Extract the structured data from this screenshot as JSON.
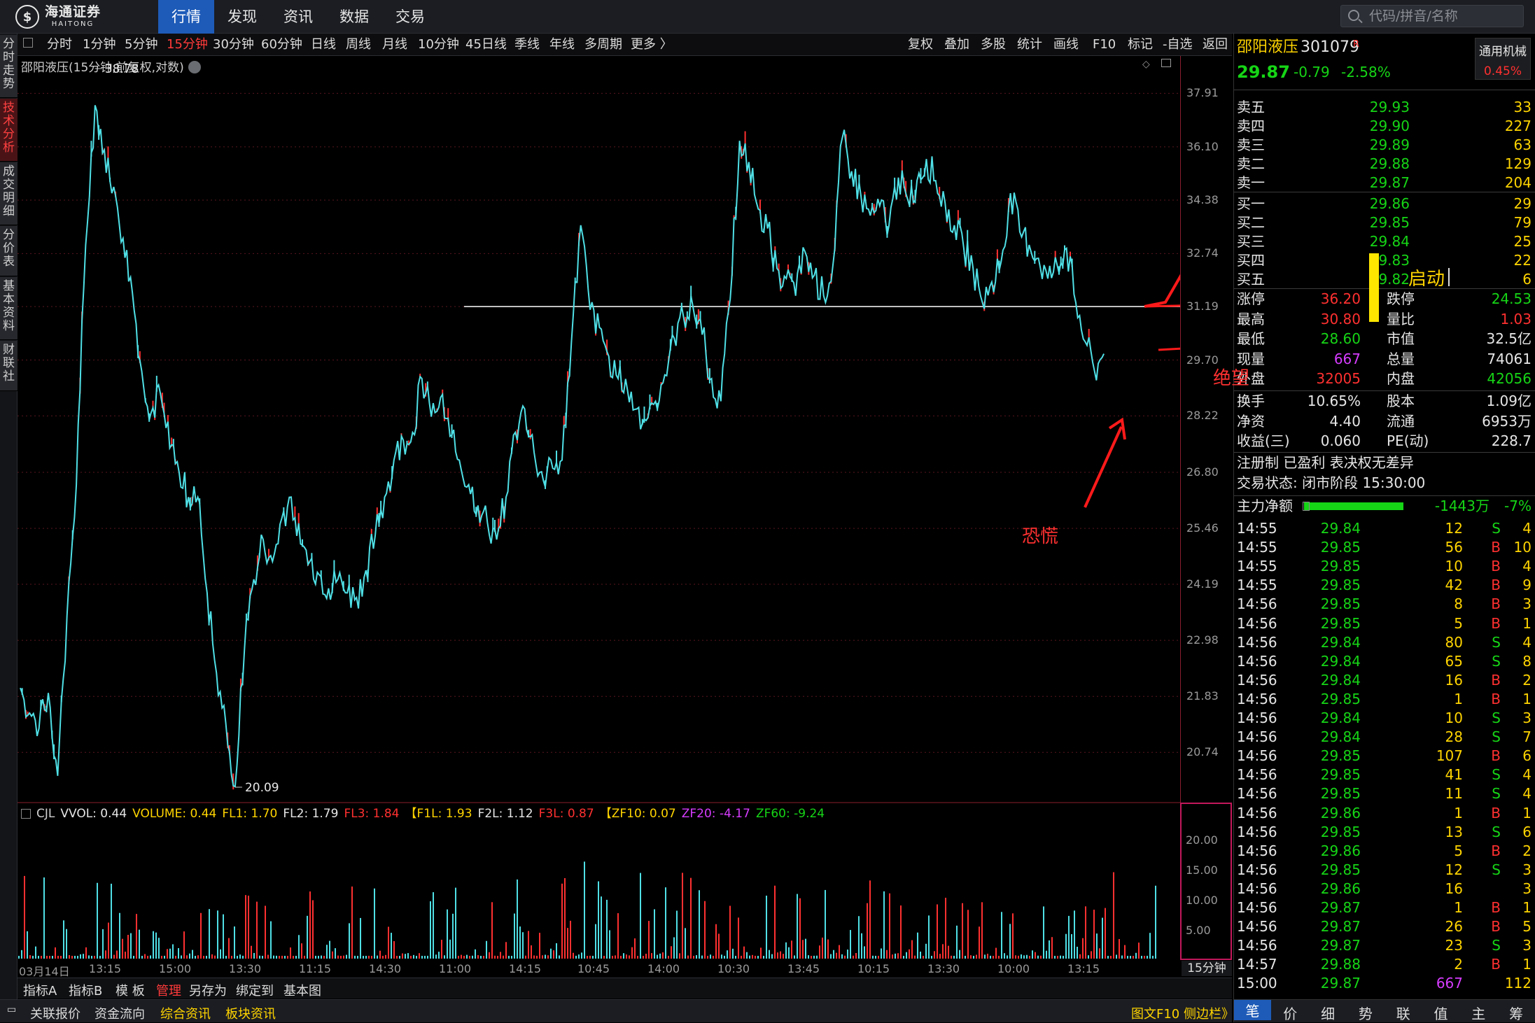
{
  "app": {
    "logo_cn": "海通证券",
    "logo_en": "HAITONG"
  },
  "nav": {
    "tabs": [
      "行情",
      "发现",
      "资讯",
      "数据",
      "交易"
    ],
    "active": "行情"
  },
  "search": {
    "placeholder": "代码/拼音/名称"
  },
  "side_tabs": [
    "分时走势",
    "技术分析",
    "成交明细",
    "分价表",
    "基本资料",
    "财联社"
  ],
  "periods": [
    "分时",
    "1分钟",
    "5分钟",
    "15分钟",
    "30分钟",
    "60分钟",
    "日线",
    "周线",
    "月线",
    "10分钟",
    "45日线",
    "季线",
    "年线",
    "多周期",
    "更多 〉"
  ],
  "active_period": "15分钟",
  "tools": [
    "复权",
    "叠加",
    "多股",
    "统计",
    "画线",
    "F10",
    "标记",
    "-自选",
    "返回"
  ],
  "chart_title": "邵阳液压(15分钟,前复权,对数)",
  "price_axis": [
    "37.91",
    "36.10",
    "34.38",
    "32.74",
    "31.19",
    "29.70",
    "28.22",
    "26.80",
    "25.46",
    "24.19",
    "22.98",
    "21.83",
    "20.74"
  ],
  "high_label": "38.78",
  "low_label": "20.09",
  "vol_axis": [
    "20.00",
    "15.00",
    "10.00",
    "5.00"
  ],
  "vol_header": [
    {
      "t": "CJL",
      "c": "#d0d0d0"
    },
    {
      "t": "VVOL: 0.44",
      "c": "#e6e6e6"
    },
    {
      "t": "VOLUME: 0.44",
      "c": "#ffd400"
    },
    {
      "t": "FL1: 1.70",
      "c": "#ffd400"
    },
    {
      "t": "FL2: 1.79",
      "c": "#e6e6e6"
    },
    {
      "t": "FL3: 1.84",
      "c": "#ff3030"
    },
    {
      "t": "【F1L: 1.93",
      "c": "#ffd400"
    },
    {
      "t": "F2L: 1.12",
      "c": "#e6e6e6"
    },
    {
      "t": "F3L: 0.87",
      "c": "#ff3030"
    },
    {
      "t": "【ZF10: 0.07",
      "c": "#ffd400"
    },
    {
      "t": "ZF20: -4.17",
      "c": "#d63cff"
    },
    {
      "t": "ZF60: -9.24",
      "c": "#16d516"
    }
  ],
  "time_axis": [
    "03月14日",
    "13:15",
    "15:00",
    "13:30",
    "11:15",
    "14:30",
    "11:00",
    "14:15",
    "10:45",
    "14:00",
    "10:30",
    "13:45",
    "10:15",
    "13:30",
    "10:00",
    "13:15"
  ],
  "period_label": "15分钟",
  "bottom_tabs1": [
    "指标A",
    "指标B",
    "模 板",
    "管理",
    "另存为",
    "绑定到",
    "基本图"
  ],
  "bottom_tabs1_active": "管理",
  "bottom_tabs2": [
    "关联报价",
    "资金流向",
    "综合资讯",
    "板块资讯"
  ],
  "bottom_right": "图文F10 侧边栏》",
  "stock": {
    "name": "邵阳液压",
    "code": "301079",
    "mark": "R",
    "industry": "通用机械",
    "industry_pct": "0.45%",
    "price": "29.87",
    "change": "-0.79",
    "pct": "-2.58%"
  },
  "asks": [
    {
      "label": "卖五",
      "price": "29.93",
      "vol": "33"
    },
    {
      "label": "卖四",
      "price": "29.90",
      "vol": "227"
    },
    {
      "label": "卖三",
      "price": "29.89",
      "vol": "63"
    },
    {
      "label": "卖二",
      "price": "29.88",
      "vol": "129"
    },
    {
      "label": "卖一",
      "price": "29.87",
      "vol": "204"
    }
  ],
  "bids": [
    {
      "label": "买一",
      "price": "29.86",
      "vol": "29"
    },
    {
      "label": "买二",
      "price": "29.85",
      "vol": "79"
    },
    {
      "label": "买三",
      "price": "29.84",
      "vol": "25"
    },
    {
      "label": "买四",
      "price": "29.83",
      "vol": "22"
    },
    {
      "label": "买五",
      "price": "29.82",
      "vol": "6"
    }
  ],
  "stats": [
    {
      "l1": "涨停",
      "v1": "36.20",
      "c1": "red",
      "l2": "跌停",
      "v2": "24.53",
      "c2": "green"
    },
    {
      "l1": "最高",
      "v1": "30.80",
      "c1": "red",
      "l2": "量比",
      "v2": "1.03",
      "c2": "red"
    },
    {
      "l1": "最低",
      "v1": "28.60",
      "c1": "green",
      "l2": "市值",
      "v2": "32.5亿",
      "c2": "white"
    },
    {
      "l1": "现量",
      "v1": "667",
      "c1": "purple",
      "l2": "总量",
      "v2": "74061",
      "c2": "white"
    },
    {
      "l1": "外盘",
      "v1": "32005",
      "c1": "red",
      "l2": "内盘",
      "v2": "42056",
      "c2": "green"
    }
  ],
  "stats2": [
    {
      "l1": "换手",
      "v1": "10.65%",
      "l2": "股本",
      "v2": "1.09亿"
    },
    {
      "l1": "净资",
      "v1": "4.40",
      "l2": "流通",
      "v2": "6953万"
    },
    {
      "l1": "收益(三)",
      "v1": "0.060",
      "l2": "PE(动)",
      "v2": "228.7"
    }
  ],
  "reg": "注册制 已盈利 表决权无差异",
  "trade_status": "交易状态: 闭市阶段 15:30:00",
  "main_flow": {
    "label": "主力净额",
    "value": "-1443万",
    "pct": "-7%"
  },
  "ticks": [
    {
      "t": "14:55",
      "p": "29.84",
      "v": "12",
      "d": "S",
      "n": "4"
    },
    {
      "t": "14:55",
      "p": "29.85",
      "v": "56",
      "d": "B",
      "n": "10"
    },
    {
      "t": "14:55",
      "p": "29.85",
      "v": "10",
      "d": "B",
      "n": "4"
    },
    {
      "t": "14:55",
      "p": "29.85",
      "v": "42",
      "d": "B",
      "n": "9"
    },
    {
      "t": "14:56",
      "p": "29.85",
      "v": "8",
      "d": "B",
      "n": "3"
    },
    {
      "t": "14:56",
      "p": "29.85",
      "v": "5",
      "d": "B",
      "n": "1"
    },
    {
      "t": "14:56",
      "p": "29.84",
      "v": "80",
      "d": "S",
      "n": "4"
    },
    {
      "t": "14:56",
      "p": "29.84",
      "v": "65",
      "d": "S",
      "n": "8"
    },
    {
      "t": "14:56",
      "p": "29.84",
      "v": "16",
      "d": "B",
      "n": "2"
    },
    {
      "t": "14:56",
      "p": "29.85",
      "v": "1",
      "d": "B",
      "n": "1"
    },
    {
      "t": "14:56",
      "p": "29.84",
      "v": "10",
      "d": "S",
      "n": "3"
    },
    {
      "t": "14:56",
      "p": "29.84",
      "v": "28",
      "d": "S",
      "n": "7"
    },
    {
      "t": "14:56",
      "p": "29.85",
      "v": "107",
      "d": "B",
      "n": "6"
    },
    {
      "t": "14:56",
      "p": "29.85",
      "v": "41",
      "d": "S",
      "n": "4"
    },
    {
      "t": "14:56",
      "p": "29.85",
      "v": "11",
      "d": "S",
      "n": "4"
    },
    {
      "t": "14:56",
      "p": "29.86",
      "v": "1",
      "d": "B",
      "n": "1"
    },
    {
      "t": "14:56",
      "p": "29.85",
      "v": "13",
      "d": "S",
      "n": "6"
    },
    {
      "t": "14:56",
      "p": "29.86",
      "v": "5",
      "d": "B",
      "n": "2"
    },
    {
      "t": "14:56",
      "p": "29.85",
      "v": "12",
      "d": "S",
      "n": "3"
    },
    {
      "t": "14:56",
      "p": "29.86",
      "v": "16",
      "d": "",
      "n": "3"
    },
    {
      "t": "14:56",
      "p": "29.87",
      "v": "1",
      "d": "B",
      "n": "1"
    },
    {
      "t": "14:56",
      "p": "29.87",
      "v": "26",
      "d": "B",
      "n": "5"
    },
    {
      "t": "14:56",
      "p": "29.87",
      "v": "23",
      "d": "S",
      "n": "3"
    },
    {
      "t": "14:57",
      "p": "29.88",
      "v": "2",
      "d": "B",
      "n": "1"
    },
    {
      "t": "15:00",
      "p": "29.87",
      "v": "667",
      "d": "",
      "n": "112"
    }
  ],
  "right_tabs": [
    "笔",
    "价",
    "细",
    "势",
    "联",
    "值",
    "主",
    "筹"
  ],
  "annotations": {
    "start": "启动",
    "despair": "绝望",
    "panic": "恐慌"
  },
  "chart_data": {
    "type": "line",
    "scale": "log",
    "ylim": [
      20.09,
      38.78
    ],
    "y_ticks": [
      37.91,
      36.1,
      34.38,
      32.74,
      31.19,
      29.7,
      28.22,
      26.8,
      25.46,
      24.19,
      22.98,
      21.83,
      20.74
    ],
    "price_path": [
      22.0,
      21.5,
      21.2,
      21.9,
      20.3,
      23.5,
      26.5,
      33.0,
      37.5,
      36.0,
      34.8,
      33.2,
      31.6,
      29.4,
      28.3,
      28.8,
      27.4,
      26.8,
      26.2,
      26.2,
      24.0,
      22.3,
      21.3,
      20.1,
      22.8,
      24.3,
      25.2,
      24.7,
      25.7,
      26.2,
      25.1,
      24.7,
      24.4,
      24.1,
      24.3,
      24.0,
      23.9,
      24.5,
      25.3,
      26.2,
      27.1,
      27.6,
      27.8,
      29.2,
      28.2,
      28.7,
      27.7,
      27.1,
      26.5,
      26.0,
      25.6,
      25.2,
      26.2,
      27.8,
      28.4,
      27.3,
      26.6,
      26.9,
      27.1,
      30.2,
      33.6,
      31.1,
      30.6,
      29.8,
      29.2,
      28.9,
      28.4,
      28.1,
      28.6,
      29.3,
      30.3,
      30.9,
      31.2,
      30.4,
      29.2,
      28.6,
      31.4,
      36.3,
      35.6,
      34.1,
      33.5,
      32.3,
      32.0,
      31.5,
      32.8,
      32.1,
      31.5,
      32.4,
      36.4,
      35.3,
      34.5,
      33.9,
      34.2,
      33.6,
      35.1,
      34.4,
      35.0,
      35.7,
      35.0,
      34.3,
      33.6,
      32.9,
      32.3,
      31.3,
      31.9,
      32.5,
      34.6,
      33.4,
      33.0,
      32.6,
      32.0,
      32.4,
      32.9,
      31.3,
      30.2,
      29.4,
      29.87
    ],
    "marked_lines": [
      {
        "label": "启动",
        "y": 31.19
      }
    ],
    "high": 38.78,
    "low": 20.09,
    "last": 29.87
  }
}
